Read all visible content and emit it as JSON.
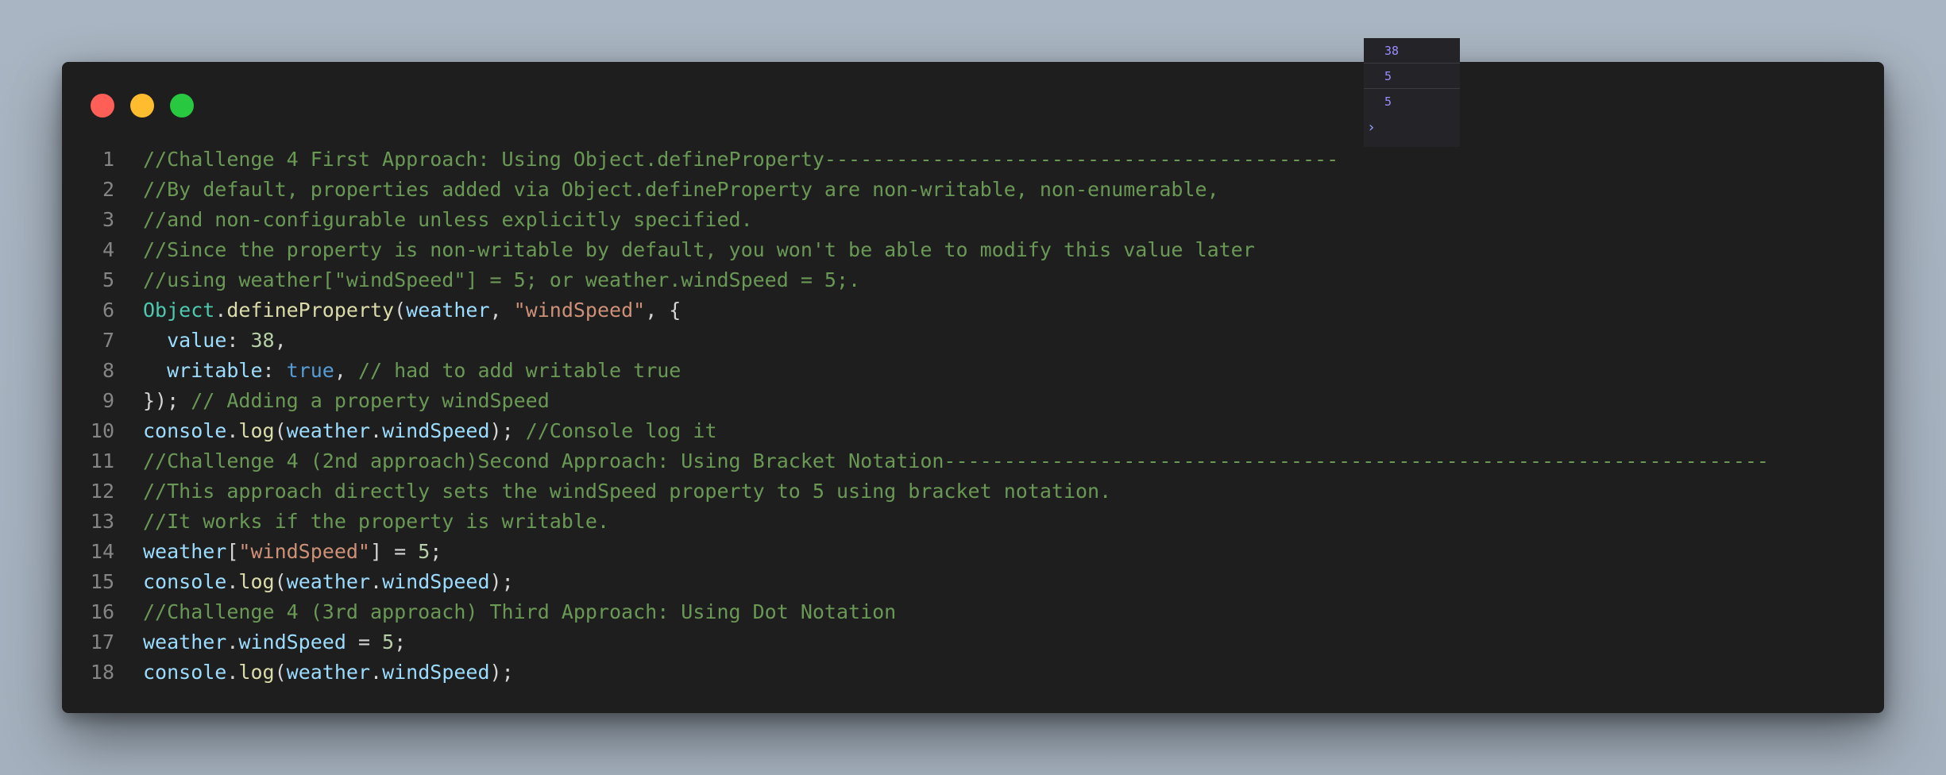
{
  "window_controls": [
    "close",
    "minimize",
    "maximize"
  ],
  "code_lines": [
    [
      [
        "c",
        "//Challenge 4 First Approach: Using Object.defineProperty-------------------------------------------"
      ]
    ],
    [
      [
        "c",
        "//By default, properties added via Object.defineProperty are non-writable, non-enumerable,"
      ]
    ],
    [
      [
        "c",
        "//and non-configurable unless explicitly specified."
      ]
    ],
    [
      [
        "c",
        "//Since the property is non-writable by default, you won't be able to modify this value later"
      ]
    ],
    [
      [
        "c",
        "//using weather[\"windSpeed\"] = 5; or weather.windSpeed = 5;."
      ]
    ],
    [
      [
        "cls",
        "Object"
      ],
      [
        "p",
        "."
      ],
      [
        "f",
        "defineProperty"
      ],
      [
        "p",
        "("
      ],
      [
        "v",
        "weather"
      ],
      [
        "p",
        ", "
      ],
      [
        "s",
        "\"windSpeed\""
      ],
      [
        "p",
        ", {"
      ]
    ],
    [
      [
        "p",
        "  "
      ],
      [
        "v",
        "value"
      ],
      [
        "p",
        ": "
      ],
      [
        "n",
        "38"
      ],
      [
        "p",
        ","
      ]
    ],
    [
      [
        "p",
        "  "
      ],
      [
        "v",
        "writable"
      ],
      [
        "p",
        ": "
      ],
      [
        "k",
        "true"
      ],
      [
        "p",
        ", "
      ],
      [
        "c",
        "// had to add writable true"
      ]
    ],
    [
      [
        "p",
        "}); "
      ],
      [
        "c",
        "// Adding a property windSpeed"
      ]
    ],
    [
      [
        "v",
        "console"
      ],
      [
        "p",
        "."
      ],
      [
        "f",
        "log"
      ],
      [
        "p",
        "("
      ],
      [
        "v",
        "weather"
      ],
      [
        "p",
        "."
      ],
      [
        "v",
        "windSpeed"
      ],
      [
        "p",
        "); "
      ],
      [
        "c",
        "//Console log it"
      ]
    ],
    [
      [
        "c",
        "//Challenge 4 (2nd approach)Second Approach: Using Bracket Notation---------------------------------------------------------------------"
      ]
    ],
    [
      [
        "c",
        "//This approach directly sets the windSpeed property to 5 using bracket notation."
      ]
    ],
    [
      [
        "c",
        "//It works if the property is writable."
      ]
    ],
    [
      [
        "v",
        "weather"
      ],
      [
        "p",
        "["
      ],
      [
        "s",
        "\"windSpeed\""
      ],
      [
        "p",
        "] = "
      ],
      [
        "n",
        "5"
      ],
      [
        "p",
        ";"
      ]
    ],
    [
      [
        "v",
        "console"
      ],
      [
        "p",
        "."
      ],
      [
        "f",
        "log"
      ],
      [
        "p",
        "("
      ],
      [
        "v",
        "weather"
      ],
      [
        "p",
        "."
      ],
      [
        "v",
        "windSpeed"
      ],
      [
        "p",
        ");"
      ]
    ],
    [
      [
        "c",
        "//Challenge 4 (3rd approach) Third Approach: Using Dot Notation"
      ]
    ],
    [
      [
        "v",
        "weather"
      ],
      [
        "p",
        "."
      ],
      [
        "v",
        "windSpeed"
      ],
      [
        "p",
        " = "
      ],
      [
        "n",
        "5"
      ],
      [
        "p",
        ";"
      ]
    ],
    [
      [
        "v",
        "console"
      ],
      [
        "p",
        "."
      ],
      [
        "f",
        "log"
      ],
      [
        "p",
        "("
      ],
      [
        "v",
        "weather"
      ],
      [
        "p",
        "."
      ],
      [
        "v",
        "windSpeed"
      ],
      [
        "p",
        ");"
      ]
    ]
  ],
  "console_output": [
    "38",
    "5",
    "5"
  ],
  "console_prompt": "›",
  "colors": {
    "background": "#a9b5c2",
    "editor": "#1e1e1e",
    "comment": "#6a9955",
    "variable": "#9cdcfe",
    "function": "#dcdcaa",
    "class": "#4ec9b0",
    "string": "#ce9178",
    "number": "#b5cea8",
    "keyword": "#569cd6",
    "console_value": "#9a8cff"
  }
}
